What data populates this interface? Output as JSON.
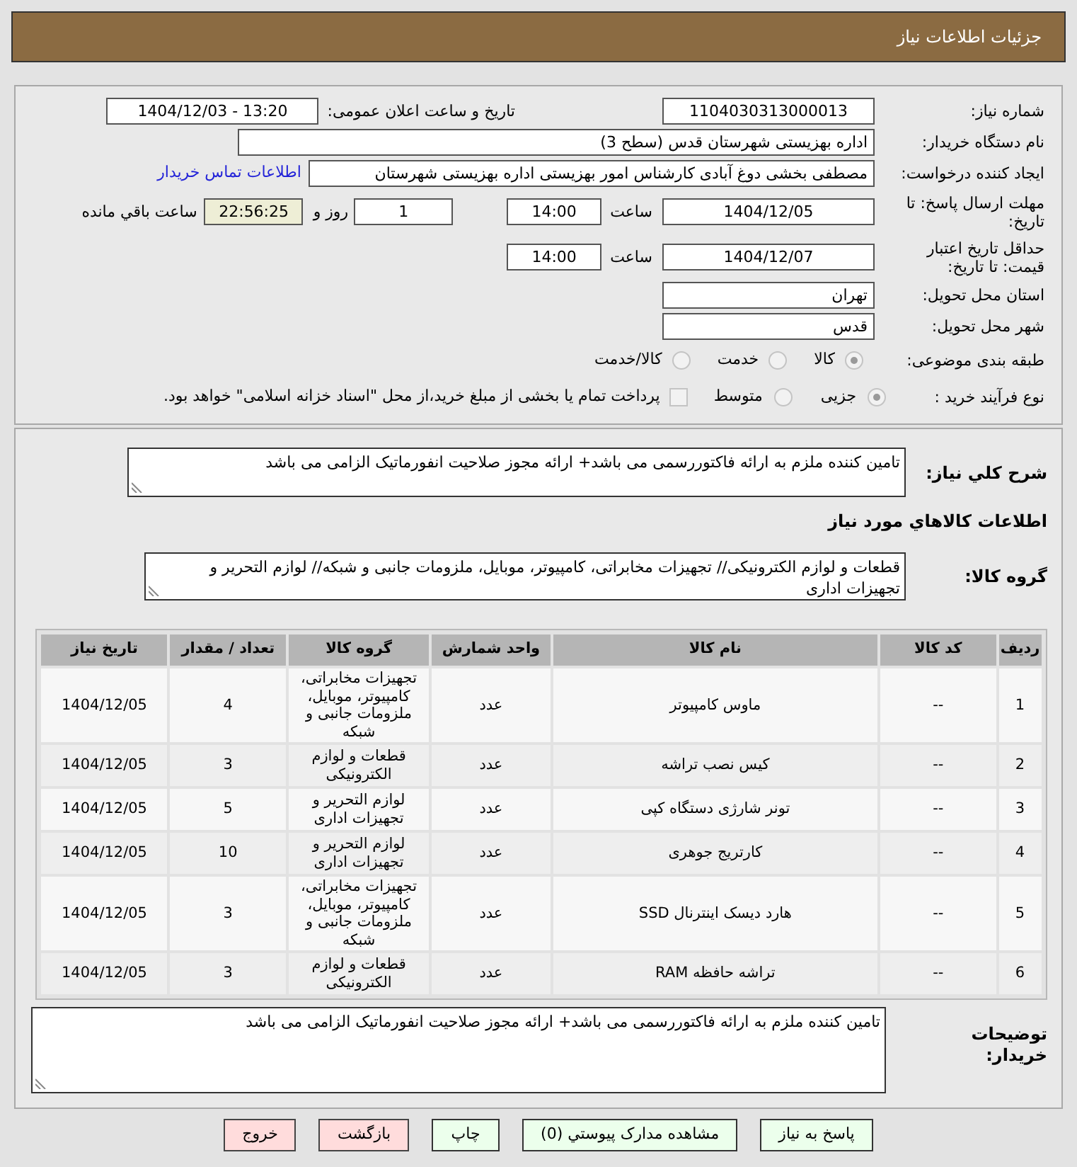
{
  "header": {
    "title": "جزئیات اطلاعات نیاز"
  },
  "form": {
    "need_number": {
      "label": "شماره نیاز:",
      "value": "1104030313000013"
    },
    "announce": {
      "label": "تاریخ و ساعت اعلان عمومی:",
      "value": "1404/12/03 - 13:20"
    },
    "buyer_org": {
      "label": "نام دستگاه خریدار:",
      "value": "اداره بهزیستی شهرستان قدس (سطح 3)"
    },
    "requester": {
      "label": "ایجاد کننده درخواست:",
      "value": "مصطفی بخشی دوغ آبادی کارشناس امور بهزیستی اداره بهزیستی شهرستان",
      "link": "اطلاعات تماس خریدار"
    },
    "reply_deadline": {
      "label": "مهلت ارسال پاسخ: تا تاریخ:",
      "date": "1404/12/05",
      "time_label": "ساعت",
      "time": "14:00",
      "days": "1",
      "days_label": "روز و",
      "remaining": "22:56:25",
      "remaining_label": "ساعت باقي مانده"
    },
    "price_validity": {
      "label": "حداقل تاریخ اعتبار قیمت: تا تاریخ:",
      "date": "1404/12/07",
      "time_label": "ساعت",
      "time": "14:00"
    },
    "province": {
      "label": "استان محل تحویل:",
      "value": "تهران"
    },
    "city": {
      "label": "شهر محل تحویل:",
      "value": "قدس"
    },
    "category": {
      "label": "طبقه بندی موضوعی:",
      "options": [
        {
          "label": "کالا",
          "selected": true,
          "disabled": true
        },
        {
          "label": "خدمت",
          "selected": false,
          "disabled": true
        },
        {
          "label": "کالا/خدمت",
          "selected": false,
          "disabled": true
        }
      ]
    },
    "process": {
      "label": "نوع فرآیند خرید :",
      "options": [
        {
          "label": "جزیی",
          "selected": true,
          "disabled": true
        },
        {
          "label": "متوسط",
          "selected": false,
          "disabled": true
        }
      ],
      "treasury": {
        "label": "پرداخت تمام یا بخشی از مبلغ خرید،از محل \"اسناد خزانه اسلامی\" خواهد بود.",
        "checked": false,
        "disabled": true
      }
    }
  },
  "summary": {
    "label": "شرح کلي نیاز:",
    "value": "تامین کننده ملزم به ارائه فاکتوررسمی می باشد+ ارائه مجوز صلاحیت انفورماتیک الزامی می باشد"
  },
  "goods_heading": "اطلاعات کالاهاي مورد نیاز",
  "goods_group": {
    "label": "گروه کالا:",
    "value": "قطعات و لوازم الکترونیکی// تجهیزات مخابراتی، کامپیوتر، موبایل، ملزومات جانبی و شبکه// لوازم التحریر و تجهیزات اداری"
  },
  "table": {
    "columns": [
      "ردیف",
      "کد کالا",
      "نام کالا",
      "واحد شمارش",
      "گروه کالا",
      "تعداد / مقدار",
      "تاریخ نیاز"
    ],
    "rows": [
      [
        "1",
        "--",
        "ماوس کامپیوتر",
        "عدد",
        "تجهیزات مخابراتی، کامپیوتر، موبایل، ملزومات جانبی و شبکه",
        "4",
        "1404/12/05"
      ],
      [
        "2",
        "--",
        "کیس نصب تراشه",
        "عدد",
        "قطعات و لوازم الکترونیکی",
        "3",
        "1404/12/05"
      ],
      [
        "3",
        "--",
        "تونر شارژی دستگاه کپی",
        "عدد",
        "لوازم التحریر و تجهیزات اداری",
        "5",
        "1404/12/05"
      ],
      [
        "4",
        "--",
        "کارتریج جوهری",
        "عدد",
        "لوازم التحریر و تجهیزات اداری",
        "10",
        "1404/12/05"
      ],
      [
        "5",
        "--",
        "هارد دیسک اینترنال SSD",
        "عدد",
        "تجهیزات مخابراتی، کامپیوتر، موبایل، ملزومات جانبی و شبکه",
        "3",
        "1404/12/05"
      ],
      [
        "6",
        "--",
        "تراشه حافظه RAM",
        "عدد",
        "قطعات و لوازم الکترونیکی",
        "3",
        "1404/12/05"
      ]
    ]
  },
  "buyer_notes": {
    "label": "توضیحات خریدار:",
    "value": "تامین کننده ملزم به ارائه فاکتوررسمی می باشد+ ارائه مجوز صلاحیت انفورماتیک الزامی می باشد"
  },
  "buttons": [
    {
      "label": "پاسخ به نیاز",
      "kind": "action"
    },
    {
      "label": "مشاهده مدارک پیوستي (0)",
      "kind": "action"
    },
    {
      "label": "چاپ",
      "kind": "action"
    },
    {
      "label": "بازگشت",
      "kind": "exit"
    },
    {
      "label": "خروج",
      "kind": "exit"
    }
  ]
}
